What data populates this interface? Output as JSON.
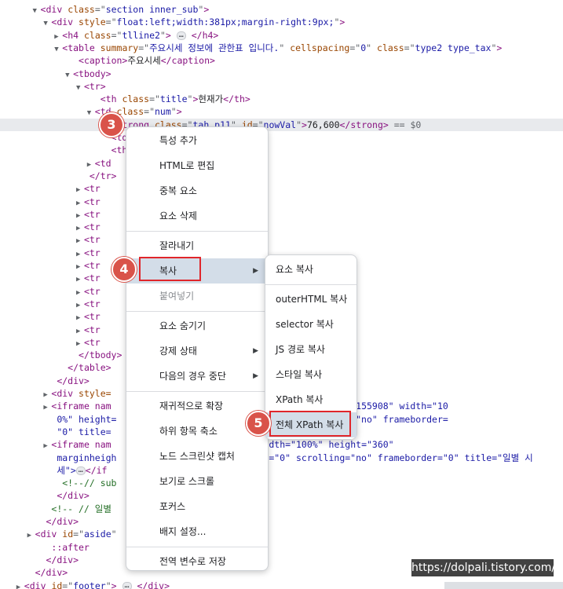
{
  "dom_tree": [
    {
      "pre": "      ",
      "tri": "▼",
      "tag": "div",
      "attrs": [
        [
          "class",
          "section inner_sub"
        ]
      ],
      "rest": ">"
    },
    {
      "pre": "        ",
      "tri": "▼",
      "tag": "div",
      "attrs": [
        [
          "style",
          "float:left;width:381px;margin-right:9px;"
        ]
      ],
      "rest": ">"
    },
    {
      "pre": "          ",
      "tri": "▶",
      "tag": "h4",
      "attrs": [
        [
          "class",
          "tlline2"
        ]
      ],
      "rest": ">",
      "ell": true,
      "close": "</h4>"
    },
    {
      "pre": "          ",
      "tri": "▼",
      "tag": "table",
      "attrs": [
        [
          "summary",
          "주요시세 정보에 관한표 입니다."
        ],
        [
          "cellspacing",
          "0"
        ],
        [
          "class",
          "type2 type_tax"
        ]
      ],
      "rest": ">"
    },
    {
      "pre": "             ",
      "tri": "",
      "tag": "caption",
      "attrs": [],
      "rest": ">",
      "text": "주요시세",
      "close": "</caption>"
    },
    {
      "pre": "            ",
      "tri": "▼",
      "tag": "tbody",
      "attrs": [],
      "rest": ">"
    },
    {
      "pre": "              ",
      "tri": "▼",
      "tag": "tr",
      "attrs": [],
      "rest": ">"
    },
    {
      "pre": "                 ",
      "tri": "",
      "tag": "th",
      "attrs": [
        [
          "class",
          "title"
        ]
      ],
      "rest": ">",
      "text": "현재가",
      "close": "</th>"
    },
    {
      "pre": "                ",
      "tri": "▼",
      "tag": "td",
      "attrs": [
        [
          "class",
          "num"
        ]
      ],
      "rest": ">"
    },
    {
      "pre": "                   ",
      "tri": "",
      "tag": "strong",
      "attrs": [
        [
          "class",
          "tah p11"
        ],
        [
          "id",
          "nowVal"
        ]
      ],
      "rest": ">",
      "text": "76,600",
      "close": "</strong>",
      "sel": true,
      "suffix": " == $0"
    },
    {
      "pre": "                   ",
      "tri": "",
      "tag": "td",
      "attrs": [],
      "rest": ""
    },
    {
      "pre": "                   ",
      "tri": "",
      "tag": "th",
      "attrs": [],
      "rest": ""
    },
    {
      "pre": "                ",
      "tri": "▶",
      "tag": "td",
      "attrs": [],
      "rest": ""
    },
    {
      "pre": "               ",
      "tri": "",
      "close": "</tr>"
    },
    {
      "pre": "              ",
      "tri": "▶",
      "tag": "tr",
      "attrs": [],
      "rest": ""
    },
    {
      "pre": "              ",
      "tri": "▶",
      "tag": "tr",
      "attrs": [],
      "rest": ""
    },
    {
      "pre": "              ",
      "tri": "▶",
      "tag": "tr",
      "attrs": [],
      "rest": ""
    },
    {
      "pre": "              ",
      "tri": "▶",
      "tag": "tr",
      "attrs": [],
      "rest": ""
    },
    {
      "pre": "              ",
      "tri": "▶",
      "tag": "tr",
      "attrs": [],
      "rest": ""
    },
    {
      "pre": "              ",
      "tri": "▶",
      "tag": "tr",
      "attrs": [],
      "rest": ""
    },
    {
      "pre": "              ",
      "tri": "▶",
      "tag": "tr",
      "attrs": [],
      "rest": ""
    },
    {
      "pre": "              ",
      "tri": "▶",
      "tag": "tr",
      "attrs": [],
      "rest": ""
    },
    {
      "pre": "              ",
      "tri": "▶",
      "tag": "tr",
      "attrs": [],
      "rest": ""
    },
    {
      "pre": "              ",
      "tri": "▶",
      "tag": "tr",
      "attrs": [],
      "rest": ""
    },
    {
      "pre": "              ",
      "tri": "▶",
      "tag": "tr",
      "attrs": [],
      "rest": ""
    },
    {
      "pre": "              ",
      "tri": "▶",
      "tag": "tr",
      "attrs": [],
      "rest": ""
    },
    {
      "pre": "              ",
      "tri": "▶",
      "tag": "tr",
      "attrs": [],
      "rest": ""
    },
    {
      "pre": "             ",
      "tri": "",
      "close": "</tbody>"
    },
    {
      "pre": "           ",
      "tri": "",
      "close": "</table>"
    },
    {
      "pre": "         ",
      "tri": "",
      "close": "</div>"
    },
    {
      "pre": "        ",
      "tri": "▶",
      "tag": "div",
      "attrs": [],
      "rest": " style=",
      "raw": true
    },
    {
      "pre": "        ",
      "tri": "▶",
      "tag": "iframe",
      "attrs": [],
      "rest": " nam",
      "tail": "                          0&thistime=20231226155908\" width=\"10"
    },
    {
      "pre": "         ",
      "tri": "",
      "cont": "0%\" height=                        argin=\"0\" scrolling=\"no\" frameborder="
    },
    {
      "pre": "         ",
      "tri": "",
      "cont": "\"0\" title=                         ",
      "tailclose": "</iframe>"
    },
    {
      "pre": "        ",
      "tri": "▶",
      "tag": "iframe",
      "attrs": [],
      "rest": " nam",
      "tail": "                         \" width=\"100%\" height=\"360\""
    },
    {
      "pre": "         ",
      "tri": "",
      "cont": "marginheigh                       argin=\"0\" scrolling=\"no\" frameborder=\"0\" title=\"일별 시"
    },
    {
      "pre": "         ",
      "tri": "",
      "cont": "세\">",
      "ellafter": true,
      "contafter": "</if"
    },
    {
      "pre": "          ",
      "tri": "",
      "comment": "<!--// sub"
    },
    {
      "pre": "         ",
      "tri": "",
      "close": "</div>"
    },
    {
      "pre": "        ",
      "tri": "",
      "comment": "<!-- // 일별"
    },
    {
      "pre": "       ",
      "tri": "",
      "close": "</div>"
    },
    {
      "pre": "     ",
      "tri": "▶",
      "tag": "div",
      "attrs": [
        [
          "id",
          "aside"
        ]
      ],
      "rest": "",
      "raw": true
    },
    {
      "pre": "        ",
      "tri": "",
      "pseudo": "::after"
    },
    {
      "pre": "       ",
      "tri": "",
      "close": "</div>"
    },
    {
      "pre": "     ",
      "tri": "",
      "close": "</div>"
    },
    {
      "pre": "   ",
      "tri": "▶",
      "tag": "div",
      "attrs": [
        [
          "id",
          "footer"
        ]
      ],
      "rest": ">",
      "ell": true,
      "close": "</div>"
    }
  ],
  "context_menu": {
    "items": [
      {
        "label": "특성 추가"
      },
      {
        "label": "HTML로 편집"
      },
      {
        "label": "중복 요소"
      },
      {
        "label": "요소 삭제"
      },
      {
        "sep": true
      },
      {
        "label": "잘라내기"
      },
      {
        "label": "복사",
        "submenu": true,
        "highlight": true
      },
      {
        "label": "붙여넣기",
        "disabled": true
      },
      {
        "sep": true
      },
      {
        "label": "요소 숨기기"
      },
      {
        "label": "강제 상태",
        "submenu": true
      },
      {
        "label": "다음의 경우 중단",
        "submenu": true
      },
      {
        "sep": true
      },
      {
        "label": "재귀적으로 확장"
      },
      {
        "label": "하위 항목 축소"
      },
      {
        "label": "노드 스크린샷 캡처"
      },
      {
        "label": "보기로 스크롤"
      },
      {
        "label": "포커스"
      },
      {
        "label": "배지 설정..."
      },
      {
        "sep": true
      },
      {
        "label": "전역 변수로 저장"
      }
    ]
  },
  "copy_submenu": {
    "items": [
      {
        "label": "요소 복사"
      },
      {
        "sep": true
      },
      {
        "label": "outerHTML 복사"
      },
      {
        "label": "selector 복사"
      },
      {
        "label": "JS 경로 복사"
      },
      {
        "label": "스타일 복사"
      },
      {
        "label": "XPath 복사"
      },
      {
        "label": "전체 XPath 복사",
        "highlight": true
      }
    ]
  },
  "steps": [
    "3",
    "4",
    "5"
  ],
  "watermark": "https://dolpali.tistory.com/"
}
